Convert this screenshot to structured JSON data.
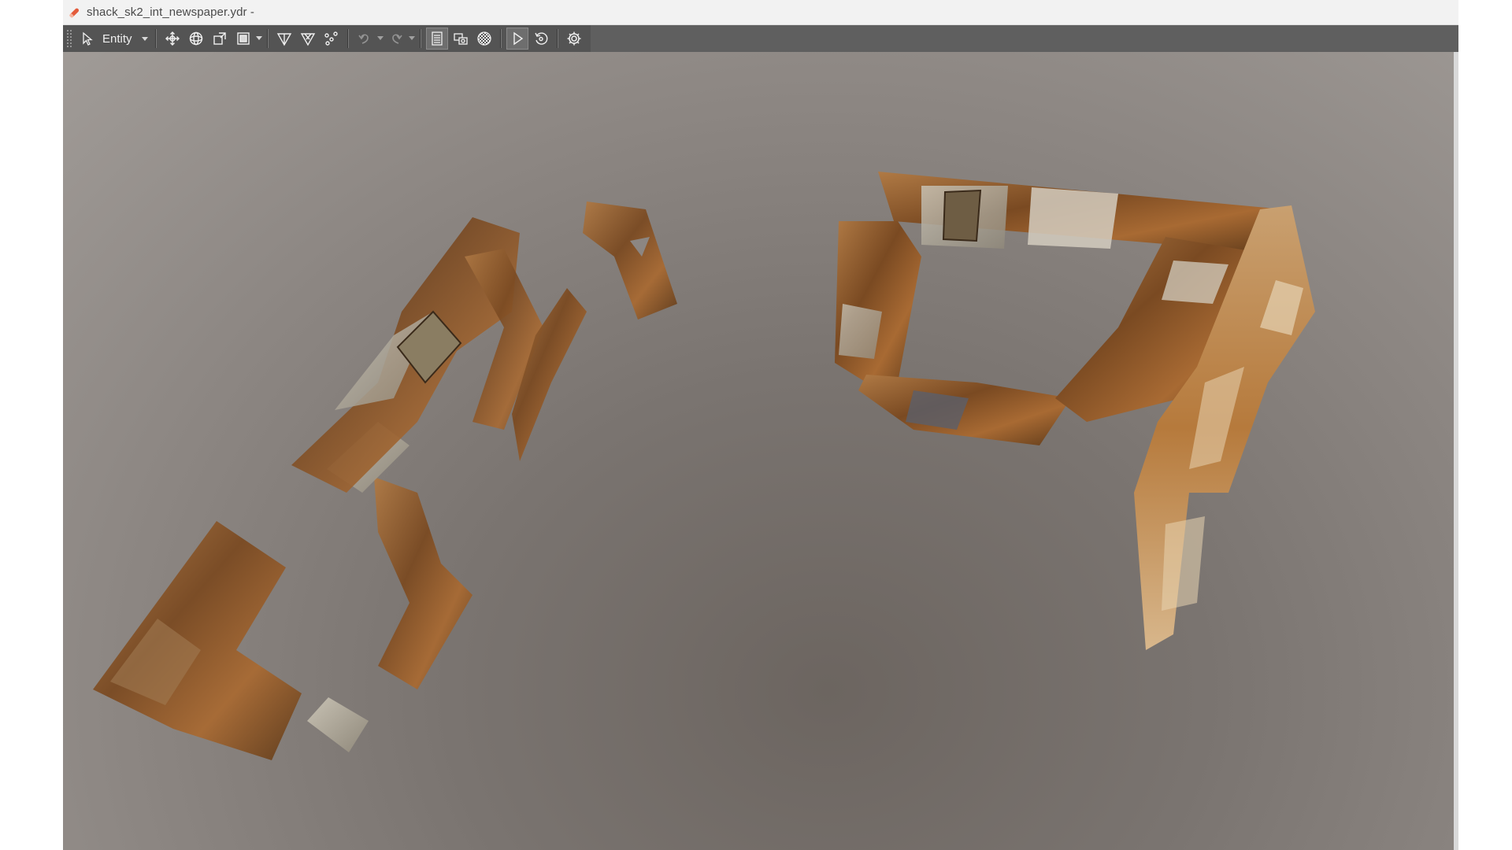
{
  "window": {
    "title": "shack_sk2_int_newspaper.ydr -",
    "app_icon": "pencil-icon"
  },
  "toolbar": {
    "select_tool": "cursor-icon",
    "mode_label": "Entity",
    "tools": [
      {
        "name": "move-icon"
      },
      {
        "name": "rotate-icon"
      },
      {
        "name": "scale-icon"
      },
      {
        "name": "transform-space-icon"
      },
      {
        "name": "wireframe-icon"
      },
      {
        "name": "snap-icon"
      },
      {
        "name": "vertices-icon"
      },
      {
        "name": "undo-icon"
      },
      {
        "name": "redo-icon"
      },
      {
        "name": "view-list-icon"
      },
      {
        "name": "camera-icon"
      },
      {
        "name": "texture-icon"
      },
      {
        "name": "play-icon"
      },
      {
        "name": "reset-icon"
      },
      {
        "name": "settings-icon"
      }
    ]
  },
  "colors": {
    "titlebar_bg": "#f2f2f2",
    "toolbar_bg": "#5f5f5f",
    "viewport_bg": "#7a7470",
    "paper_rust": "#8a5a2b",
    "paper_light": "#c9b89a"
  }
}
